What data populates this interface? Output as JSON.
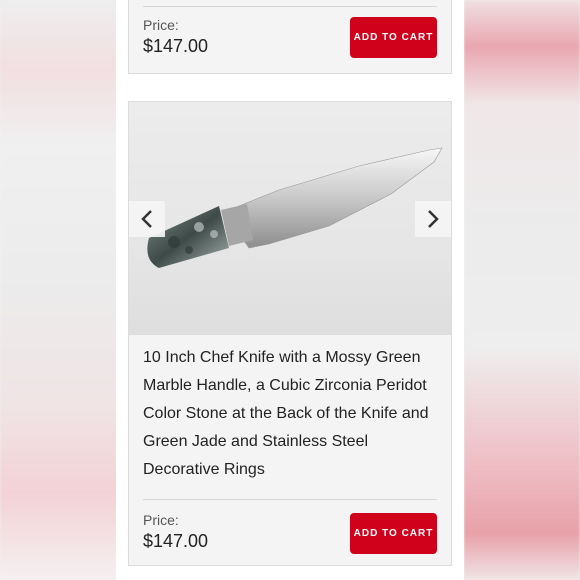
{
  "product_top": {
    "price_label": "Price:",
    "price": "$147.00",
    "button_label": "ADD TO CART"
  },
  "product_main": {
    "title": "10 Inch Chef Knife with a Mossy Green Marble Handle, a Cubic Zirconia Peridot Color Stone at the Back of the Knife and Green Jade and Stainless Steel Decorative Rings",
    "price_label": "Price:",
    "price": "$147.00",
    "button_label": "ADD TO CART",
    "carousel": {
      "prev_icon": "chevron-left-icon",
      "next_icon": "chevron-right-icon"
    }
  },
  "colors": {
    "accent": "#d0021b",
    "card_bg": "#f4f4f4"
  }
}
